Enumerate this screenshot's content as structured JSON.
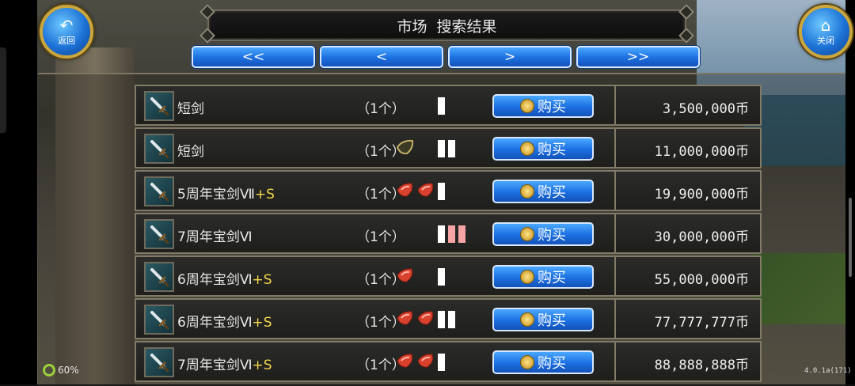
{
  "header": {
    "title": "市场  搜索结果",
    "back_label": "返回",
    "close_label": "关闭"
  },
  "nav": {
    "first": "<<",
    "prev": "<",
    "next": ">",
    "last": ">>"
  },
  "items": [
    {
      "name": "短剑",
      "plus": "",
      "count": "（1个）",
      "gems": [],
      "bars": [
        "white"
      ],
      "buy": "购买",
      "price": "3,500,000币"
    },
    {
      "name": "短剑",
      "plus": "",
      "count": "（1个）",
      "gems": [
        "seed"
      ],
      "bars": [
        "white",
        "white"
      ],
      "buy": "购买",
      "price": "11,000,000币"
    },
    {
      "name": "5周年宝剑Ⅶ",
      "plus": "+S",
      "count": "（1个）",
      "gems": [
        "red",
        "red"
      ],
      "bars": [
        "white"
      ],
      "buy": "购买",
      "price": "19,900,000币"
    },
    {
      "name": "7周年宝剑Ⅵ",
      "plus": "",
      "count": "（1个）",
      "gems": [],
      "bars": [
        "white",
        "pink",
        "pink"
      ],
      "buy": "购买",
      "price": "30,000,000币"
    },
    {
      "name": "6周年宝剑Ⅵ",
      "plus": "+S",
      "count": "（1个）",
      "gems": [
        "red"
      ],
      "bars": [
        "white"
      ],
      "buy": "购买",
      "price": "55,000,000币"
    },
    {
      "name": "6周年宝剑Ⅵ",
      "plus": "+S",
      "count": "（1个）",
      "gems": [
        "red",
        "red"
      ],
      "bars": [
        "white",
        "white"
      ],
      "buy": "购买",
      "price": "77,777,777币"
    },
    {
      "name": "7周年宝剑Ⅵ",
      "plus": "+S",
      "count": "（1个）",
      "gems": [
        "red",
        "red"
      ],
      "bars": [
        "white"
      ],
      "buy": "购买",
      "price": "88,888,888币"
    }
  ],
  "status": {
    "battery": "60%",
    "version": "4.0.1a(171)"
  },
  "icons": {
    "item_icon": "sword-icon",
    "buy_icon": "coin-icon"
  },
  "colors": {
    "button_blue": "#1b6fe0",
    "plus_yellow": "#f2d64b",
    "gem_red": "#d8412e",
    "bar_pink": "#f6a4a4"
  }
}
